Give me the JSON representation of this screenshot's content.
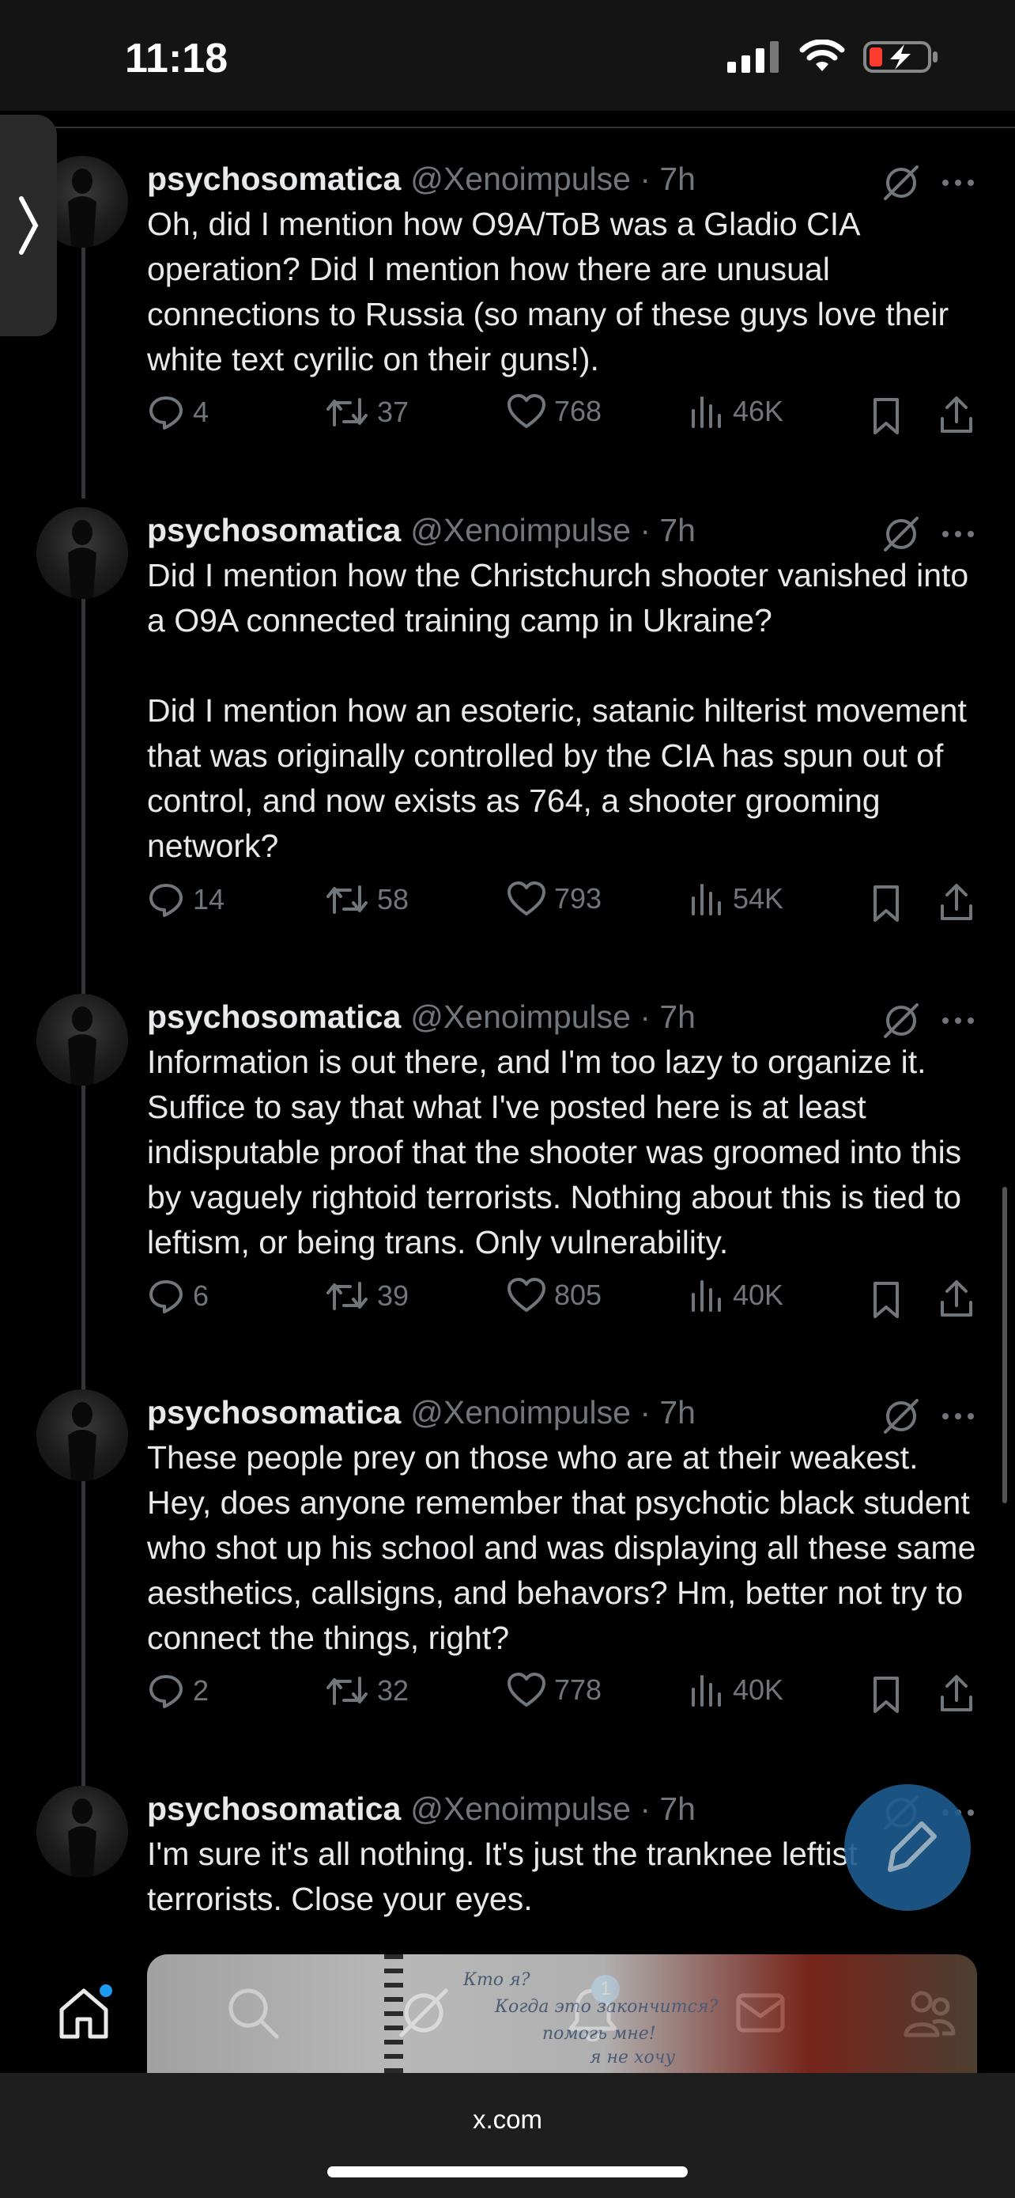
{
  "status_bar": {
    "time": "11:18"
  },
  "author": {
    "name": "psychosomatica",
    "handle": "@Xenoimpulse · 7h"
  },
  "tweets": [
    {
      "text": "Oh, did I mention how O9A/ToB was a Gladio CIA operation? Did I mention how there are unusual connections to Russia (so many of these guys love their white text cyrilic on their guns!).",
      "replies": "4",
      "reposts": "37",
      "likes": "768",
      "views": "46K"
    },
    {
      "text": "Did I mention how the Christchurch shooter vanished into a O9A connected training camp in Ukraine?\n\nDid I mention how an esoteric, satanic hilterist movement that was originally controlled by the CIA has spun out of control, and now exists as 764, a shooter grooming network?",
      "replies": "14",
      "reposts": "58",
      "likes": "793",
      "views": "54K"
    },
    {
      "text": "Information is out there, and I'm too lazy to organize it. Suffice to say that what I've posted here is at least indisputable proof that the shooter was groomed into this by vaguely rightoid terrorists. Nothing about this is tied to leftism, or being trans. Only vulnerability.",
      "replies": "6",
      "reposts": "39",
      "likes": "805",
      "views": "40K"
    },
    {
      "text": "These people prey on those who are at their weakest. Hey, does anyone remember that psychotic black student who shot up his school and was displaying all these same aesthetics, callsigns, and behavors? Hm, better not try to connect the things, right?",
      "replies": "2",
      "reposts": "32",
      "likes": "778",
      "views": "40K"
    },
    {
      "text": "I'm sure it's all nothing. It's just the tranknee leftist terrorists. Close your eyes."
    }
  ],
  "nav": {
    "notifications_badge": "1"
  },
  "photo_overlay": {
    "line1": "Кто я?",
    "line2": "Когда это закончится?",
    "line3": "помогь мне!",
    "line4": "я не хочу"
  },
  "browser": {
    "url": "x.com"
  },
  "colors": {
    "accent": "#1d9bf0",
    "muted": "#71767b",
    "text": "#e7e9ea",
    "background": "#000000"
  }
}
